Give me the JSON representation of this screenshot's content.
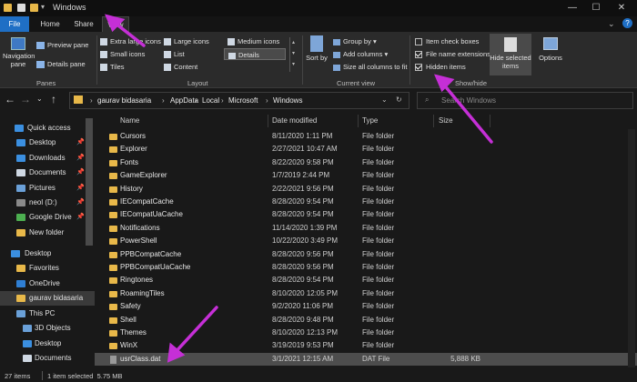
{
  "window": {
    "title": "Windows"
  },
  "ribbon_tabs": [
    "File",
    "Home",
    "Share",
    "View"
  ],
  "ribbon": {
    "panes": {
      "navigation_pane": "Navigation pane",
      "preview_pane": "Preview pane",
      "details_pane": "Details pane",
      "group_label": "Panes"
    },
    "layout": {
      "items": [
        "Extra large icons",
        "Large icons",
        "Medium icons",
        "Small icons",
        "List",
        "Details",
        "Tiles",
        "Content"
      ],
      "group_label": "Layout"
    },
    "current_view": {
      "sort_by": "Sort by",
      "group_by": "Group by",
      "add_columns": "Add columns",
      "size_all_columns": "Size all columns to fit",
      "group_label": "Current view"
    },
    "show_hide": {
      "item_check_boxes": "Item check boxes",
      "file_name_extensions": "File name extensions",
      "hidden_items": "Hidden items",
      "hide_selected": "Hide selected items",
      "options": "Options",
      "group_label": "Show/hide"
    }
  },
  "address": {
    "path": [
      "gaurav bidasaria",
      "AppData",
      "Local",
      "Microsoft",
      "Windows"
    ],
    "search_placeholder": "Search Windows"
  },
  "nav": {
    "items": [
      {
        "label": "Quick access",
        "icon": "star-icon"
      },
      {
        "label": "Desktop",
        "icon": "desktop-icon"
      },
      {
        "label": "Downloads",
        "icon": "download-icon"
      },
      {
        "label": "Documents",
        "icon": "document-icon"
      },
      {
        "label": "Pictures",
        "icon": "picture-icon"
      },
      {
        "label": "neol (D:)",
        "icon": "drive-icon"
      },
      {
        "label": "Google Drive",
        "icon": "google-drive-icon"
      },
      {
        "label": "New folder",
        "icon": "folder-icon"
      },
      {
        "label": "Desktop",
        "icon": "desktop-icon"
      },
      {
        "label": "Favorites",
        "icon": "star-icon"
      },
      {
        "label": "OneDrive",
        "icon": "cloud-icon"
      },
      {
        "label": "gaurav bidasaria",
        "icon": "user-icon"
      },
      {
        "label": "This PC",
        "icon": "pc-icon"
      },
      {
        "label": "3D Objects",
        "icon": "cube-icon"
      },
      {
        "label": "Desktop",
        "icon": "desktop-icon"
      },
      {
        "label": "Documents",
        "icon": "document-icon"
      }
    ]
  },
  "columns": {
    "name": "Name",
    "date": "Date modified",
    "type": "Type",
    "size": "Size"
  },
  "files": [
    {
      "name": "Cursors",
      "date": "8/11/2020 1:11 PM",
      "type": "File folder",
      "size": ""
    },
    {
      "name": "Explorer",
      "date": "2/27/2021 10:47 AM",
      "type": "File folder",
      "size": ""
    },
    {
      "name": "Fonts",
      "date": "8/22/2020 9:58 PM",
      "type": "File folder",
      "size": ""
    },
    {
      "name": "GameExplorer",
      "date": "1/7/2019 2:44 PM",
      "type": "File folder",
      "size": ""
    },
    {
      "name": "History",
      "date": "2/22/2021 9:56 PM",
      "type": "File folder",
      "size": ""
    },
    {
      "name": "IECompatCache",
      "date": "8/28/2020 9:54 PM",
      "type": "File folder",
      "size": ""
    },
    {
      "name": "IECompatUaCache",
      "date": "8/28/2020 9:54 PM",
      "type": "File folder",
      "size": ""
    },
    {
      "name": "Notifications",
      "date": "11/14/2020 1:39 PM",
      "type": "File folder",
      "size": ""
    },
    {
      "name": "PowerShell",
      "date": "10/22/2020 3:49 PM",
      "type": "File folder",
      "size": ""
    },
    {
      "name": "PPBCompatCache",
      "date": "8/28/2020 9:56 PM",
      "type": "File folder",
      "size": ""
    },
    {
      "name": "PPBCompatUaCache",
      "date": "8/28/2020 9:56 PM",
      "type": "File folder",
      "size": ""
    },
    {
      "name": "Ringtones",
      "date": "8/28/2020 9:54 PM",
      "type": "File folder",
      "size": ""
    },
    {
      "name": "RoamingTiles",
      "date": "8/10/2020 12:05 PM",
      "type": "File folder",
      "size": ""
    },
    {
      "name": "Safety",
      "date": "9/2/2020 11:06 PM",
      "type": "File folder",
      "size": ""
    },
    {
      "name": "Shell",
      "date": "8/28/2020 9:48 PM",
      "type": "File folder",
      "size": ""
    },
    {
      "name": "Themes",
      "date": "8/10/2020 12:13 PM",
      "type": "File folder",
      "size": ""
    },
    {
      "name": "WinX",
      "date": "3/19/2019 9:53 PM",
      "type": "File folder",
      "size": ""
    },
    {
      "name": "usrClass.dat",
      "date": "3/1/2021 12:15 AM",
      "type": "DAT File",
      "size": "5,888 KB"
    }
  ],
  "status": {
    "count": "27 items",
    "selection": "1 item selected  5.75 MB"
  },
  "colors": {
    "accent": "#1f6fc5",
    "annotation_arrow": "#c52fd6",
    "folder": "#e8b849"
  }
}
